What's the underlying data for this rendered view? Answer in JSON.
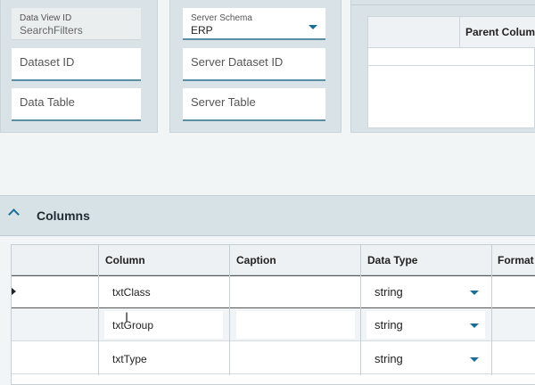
{
  "left_panel": {
    "data_view": {
      "label": "Data View ID",
      "value": "SearchFilters"
    },
    "dataset_id": {
      "placeholder": "Dataset ID"
    },
    "data_table": {
      "placeholder": "Data Table"
    }
  },
  "mid_panel": {
    "server_schema": {
      "label": "Server Schema",
      "value": "ERP"
    },
    "server_dataset_id": {
      "placeholder": "Server Dataset ID"
    },
    "server_table": {
      "placeholder": "Server Table"
    }
  },
  "right_panel": {
    "grid_header": "Parent Column"
  },
  "columns_section": {
    "title": "Columns",
    "headers": [
      "Column",
      "Caption",
      "Data Type",
      "Format"
    ],
    "rows": [
      {
        "column": "txtClass",
        "caption": "",
        "data_type": "string"
      },
      {
        "column": "txtGroup",
        "caption": "",
        "data_type": "string"
      },
      {
        "column": "txtType",
        "caption": "",
        "data_type": "string"
      }
    ]
  },
  "colors": {
    "accent": "#1a6d96",
    "panel": "#d9e3e7",
    "underline": "#5b8ea3"
  },
  "icons": {
    "dropdown": "chevron-down-icon",
    "collapse": "chevron-up-icon",
    "row_pointer": "row-pointer-icon",
    "cursor": "text-cursor-icon"
  }
}
